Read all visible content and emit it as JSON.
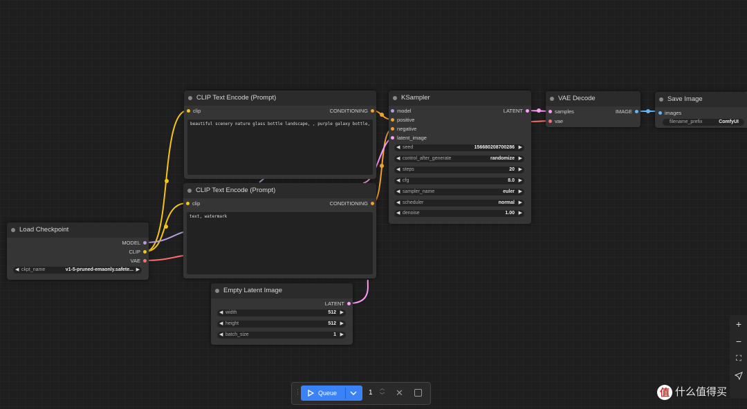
{
  "nodes": {
    "clip_encode_1": {
      "title": "CLIP Text Encode (Prompt)",
      "input_clip": "clip",
      "output": "CONDITIONING",
      "text": "beautiful scenery nature glass bottle landscape, , purple galaxy bottle,"
    },
    "clip_encode_2": {
      "title": "CLIP Text Encode (Prompt)",
      "input_clip": "clip",
      "output": "CONDITIONING",
      "text": "text, watermark"
    },
    "ksampler": {
      "title": "KSampler",
      "inputs": [
        "model",
        "positive",
        "negative",
        "latent_image"
      ],
      "output": "LATENT",
      "widgets": [
        {
          "label": "seed",
          "value": "156680208700286"
        },
        {
          "label": "control_after_generate",
          "value": "randomize"
        },
        {
          "label": "steps",
          "value": "20"
        },
        {
          "label": "cfg",
          "value": "8.0"
        },
        {
          "label": "sampler_name",
          "value": "euler"
        },
        {
          "label": "scheduler",
          "value": "normal"
        },
        {
          "label": "denoise",
          "value": "1.00"
        }
      ]
    },
    "vae_decode": {
      "title": "VAE Decode",
      "inputs": [
        "samples",
        "vae"
      ],
      "output": "IMAGE"
    },
    "save_image": {
      "title": "Save Image",
      "input": "images",
      "widget_label": "filename_prefix",
      "widget_value": "ComfyUI"
    },
    "load_checkpoint": {
      "title": "Load Checkpoint",
      "outputs": [
        "MODEL",
        "CLIP",
        "VAE"
      ],
      "widget_label": "ckpt_name",
      "widget_value": "v1-5-pruned-emaonly.safete..."
    },
    "empty_latent": {
      "title": "Empty Latent Image",
      "output": "LATENT",
      "widgets": [
        {
          "label": "width",
          "value": "512"
        },
        {
          "label": "height",
          "value": "512"
        },
        {
          "label": "batch_size",
          "value": "1"
        }
      ]
    }
  },
  "queue": {
    "label": "Queue",
    "count": "1"
  },
  "zoom_controls": [
    "plus-icon",
    "minus-icon",
    "fit-view-icon",
    "locate-icon"
  ],
  "watermark": {
    "logo_char": "值",
    "text": "什么值得买"
  },
  "colors": {
    "clip": "#f5c518",
    "conditioning": "#f0a030",
    "model": "#b39ddb",
    "vae": "#ff6e6e",
    "latent": "#ff9cf9",
    "image": "#64b5f6",
    "queue_button": "#3b82f6"
  }
}
